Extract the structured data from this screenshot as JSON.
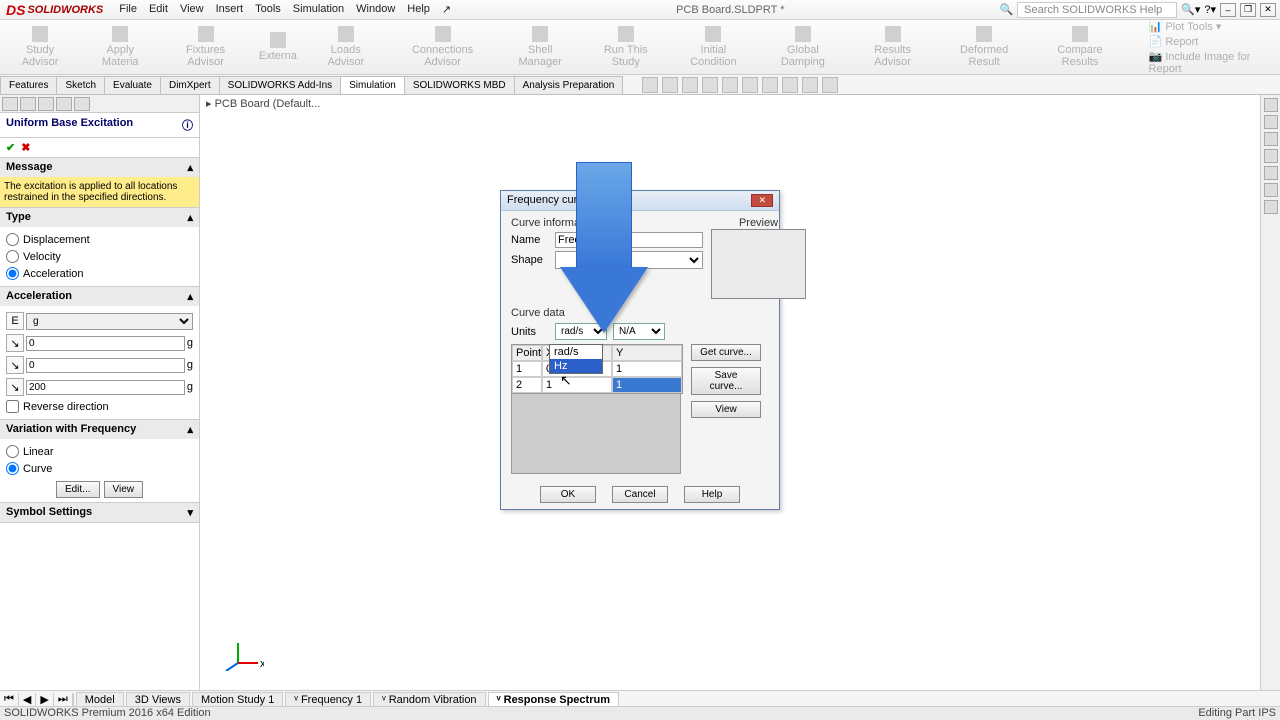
{
  "app": {
    "name": "SOLIDWORKS",
    "doc_title": "PCB Board.SLDPRT *",
    "search_placeholder": "Search SOLIDWORKS Help"
  },
  "menu": [
    "File",
    "Edit",
    "View",
    "Insert",
    "Tools",
    "Simulation",
    "Window",
    "Help"
  ],
  "ribbon": [
    {
      "label": "Study Advisor"
    },
    {
      "label": "Apply Materia"
    },
    {
      "label": "Fixtures Advisor"
    },
    {
      "label": "Externa"
    },
    {
      "label": "Loads Advisor"
    },
    {
      "label": "Connections Advisor"
    },
    {
      "label": "Shell Manager"
    },
    {
      "label": "Run This Study"
    },
    {
      "label": "Initial Condition"
    },
    {
      "label": "Global Damping"
    },
    {
      "label": "Results Advisor"
    },
    {
      "label": "Deformed Result"
    },
    {
      "label": "Compare Results"
    }
  ],
  "ribbon_right": [
    "Plot Tools",
    "Report",
    "Include Image for Report"
  ],
  "cmd_tabs": [
    "Features",
    "Sketch",
    "Evaluate",
    "DimXpert",
    "SOLIDWORKS Add-Ins",
    "Simulation",
    "SOLIDWORKS MBD",
    "Analysis Preparation"
  ],
  "cmd_active": "Simulation",
  "breadcrumb": "PCB Board  (Default...",
  "pmgr": {
    "title": "Uniform Base Excitation",
    "message_hdr": "Message",
    "message": "The excitation is applied to all locations restrained in the specified directions.",
    "type_hdr": "Type",
    "type_opts": [
      "Displacement",
      "Velocity",
      "Acceleration"
    ],
    "type_sel": "Acceleration",
    "accel_hdr": "Acceleration",
    "accel_unit_sel": "g",
    "accel_rows": [
      {
        "val": "0",
        "unit": "g"
      },
      {
        "val": "0",
        "unit": "g"
      },
      {
        "val": "200",
        "unit": "g"
      }
    ],
    "reverse": "Reverse direction",
    "varfreq_hdr": "Variation with Frequency",
    "varfreq_opts": [
      "Linear",
      "Curve"
    ],
    "varfreq_sel": "Curve",
    "edit_btn": "Edit...",
    "view_btn": "View",
    "symset_hdr": "Symbol Settings"
  },
  "dialog": {
    "title": "Frequency curve",
    "curve_info": "Curve information",
    "name_lbl": "Name",
    "name_val": "Frequ",
    "shape_lbl": "Shape",
    "preview_lbl": "Preview",
    "curve_data": "Curve data",
    "units_lbl": "Units",
    "units_x": "rad/s",
    "units_y": "N/A",
    "dropdown_items": [
      "rad/s",
      "Hz"
    ],
    "points_lbl": "Points",
    "hdr_x": "X",
    "hdr_y": "Y",
    "rows": [
      {
        "n": "1",
        "x": "0",
        "y": "1"
      },
      {
        "n": "2",
        "x": "1",
        "y": "1"
      }
    ],
    "get_curve": "Get curve...",
    "save_curve": "Save curve...",
    "view": "View",
    "ok": "OK",
    "cancel": "Cancel",
    "help": "Help"
  },
  "bottom_tabs": [
    "Model",
    "3D Views",
    "Motion Study 1",
    "Frequency 1",
    "Random Vibration",
    "Response Spectrum"
  ],
  "bottom_active": "Response Spectrum",
  "status_left": "SOLIDWORKS Premium 2016 x64 Edition",
  "status_right": "Editing Part        IPS"
}
